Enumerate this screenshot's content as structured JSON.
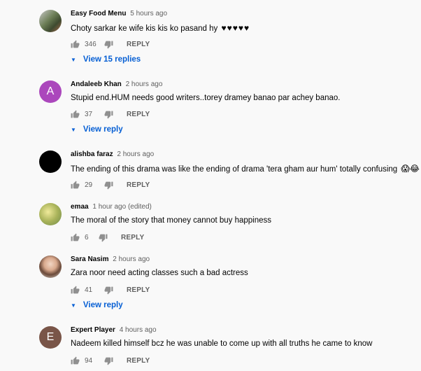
{
  "labels": {
    "reply": "REPLY"
  },
  "comments": [
    {
      "author": "Easy Food Menu",
      "time": "5 hours ago",
      "text": "Choty sarkar ke wife kis kis ko pasand hy",
      "text_suffix": "♥♥♥♥♥",
      "likes": "346",
      "replies_label": "View 15 replies",
      "avatar_letter": "",
      "avatar_color": "#8c9a7a"
    },
    {
      "author": "Andaleeb Khan",
      "time": "2 hours ago",
      "text": "Stupid end.HUM needs good writers..torey dramey banao par achey banao.",
      "likes": "37",
      "replies_label": "View reply",
      "avatar_letter": "A",
      "avatar_color": "#7e57c2"
    },
    {
      "author": "alishba faraz",
      "time": "2 hours ago",
      "text": "The ending of this drama was like the ending of drama 'tera gham aur hum' totally confusing",
      "text_suffix": "😱😂",
      "likes": "29",
      "avatar_letter": "",
      "avatar_color": "#000000"
    },
    {
      "author": "emaa",
      "time": "1 hour ago (edited)",
      "text": "The moral of the story that  money cannot buy happiness",
      "likes": "6",
      "avatar_letter": "",
      "avatar_color": "#c7c26a"
    },
    {
      "author": "Sara Nasim",
      "time": "2 hours ago",
      "text": "Zara noor need acting classes such a bad actress",
      "likes": "41",
      "replies_label": "View reply",
      "avatar_letter": "",
      "avatar_color": "#d9b8a6"
    },
    {
      "author": "Expert Player",
      "time": "4 hours ago",
      "text": "Nadeem killed himself bcz he was unable to come up with all truths he came to know",
      "likes": "94",
      "avatar_letter": "E",
      "avatar_color": "#795548"
    }
  ]
}
